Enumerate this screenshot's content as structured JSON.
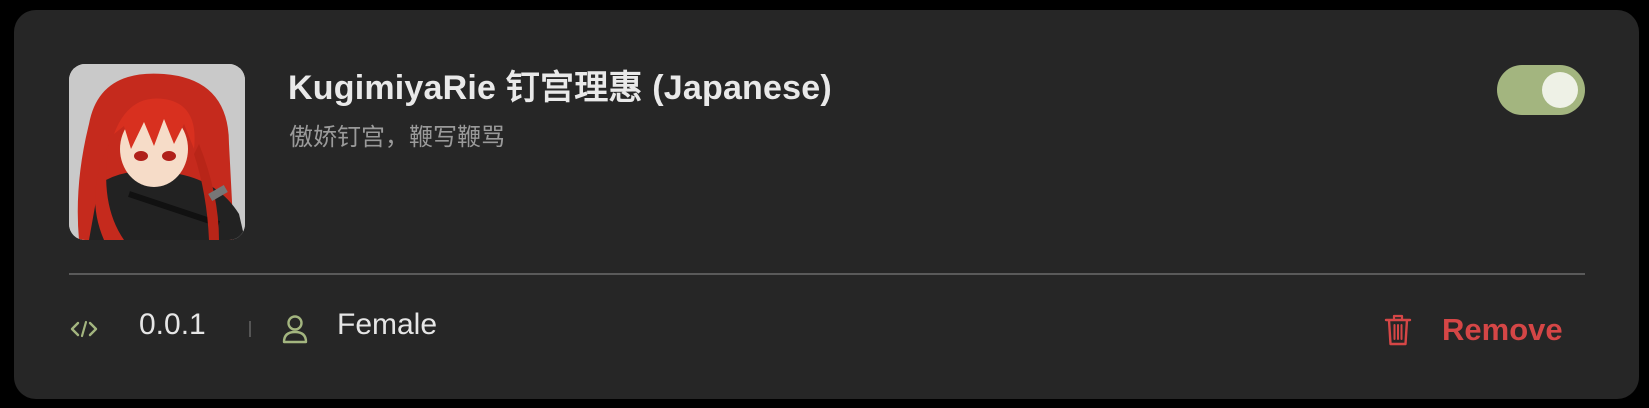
{
  "voice": {
    "name": "KugimiyaRie 钉宫理惠 (Japanese)",
    "description": "傲娇钉宫，鞭写鞭骂",
    "enabled": true,
    "avatar_icon": "anime-character-avatar"
  },
  "meta": {
    "version": "0.0.1",
    "version_icon": "code-icon",
    "gender": "Female",
    "gender_icon": "user-icon"
  },
  "actions": {
    "remove_label": "Remove",
    "remove_icon": "trash-icon"
  },
  "colors": {
    "card_bg": "#262626",
    "accent_green": "#a3b57f",
    "danger_red": "#d54646",
    "title_text": "#e9e9e9",
    "subtitle_text": "#9a9a9a"
  }
}
